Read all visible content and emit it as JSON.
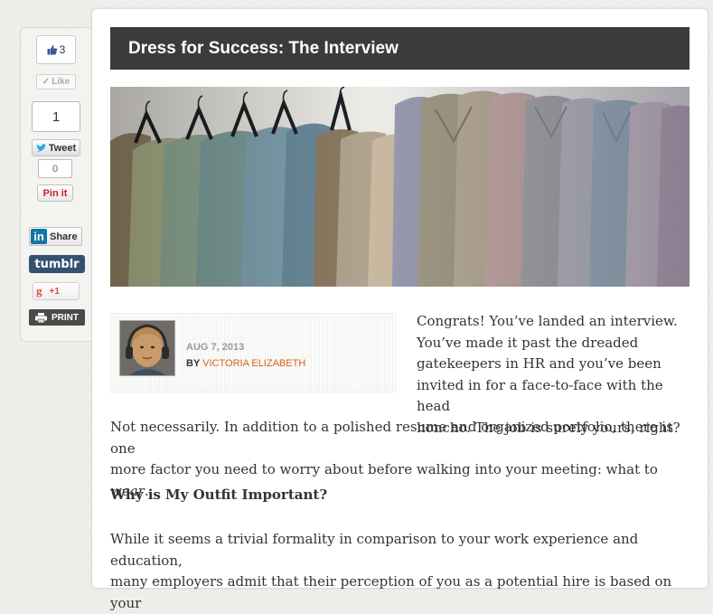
{
  "share": {
    "facebook": {
      "count": "3",
      "like_label": "Like"
    },
    "twitter": {
      "count": "1",
      "tweet_label": "Tweet"
    },
    "pinterest": {
      "count": "0",
      "label": "Pin it"
    },
    "linkedin": {
      "logo": "in",
      "label": "Share"
    },
    "tumblr": {
      "label": "tumblr"
    },
    "gplus": {
      "logo": "g",
      "label": "+1"
    },
    "print": {
      "label": "PRINT"
    }
  },
  "article": {
    "title": "Dress for Success: The Interview",
    "date": "AUG 7, 2013",
    "by_label": "BY",
    "author": "VICTORIA ELIZABETH",
    "intro_lines": [
      "Congrats! You’ve landed an interview.",
      "You’ve made it past the dreaded",
      "gatekeepers in HR and you’ve been",
      "invited in for a face-to-face with the head",
      "honcho. The job is surely yours, right?"
    ],
    "intro_rest_lines": [
      "Not necessarily. In addition to a polished resume and organized portfolio, there is one"
    ],
    "intro_last_prefix": "more factor you need to worry about before walking into your meeting: what to ",
    "intro_last_em": "wear",
    "intro_last_suffix": ".",
    "heading": "Why is My Outfit Important?",
    "para2_lines": [
      "While it seems a trivial formality in comparison to your work experience and education,",
      "many employers admit that their perception of you as a potential hire is based on your"
    ]
  }
}
